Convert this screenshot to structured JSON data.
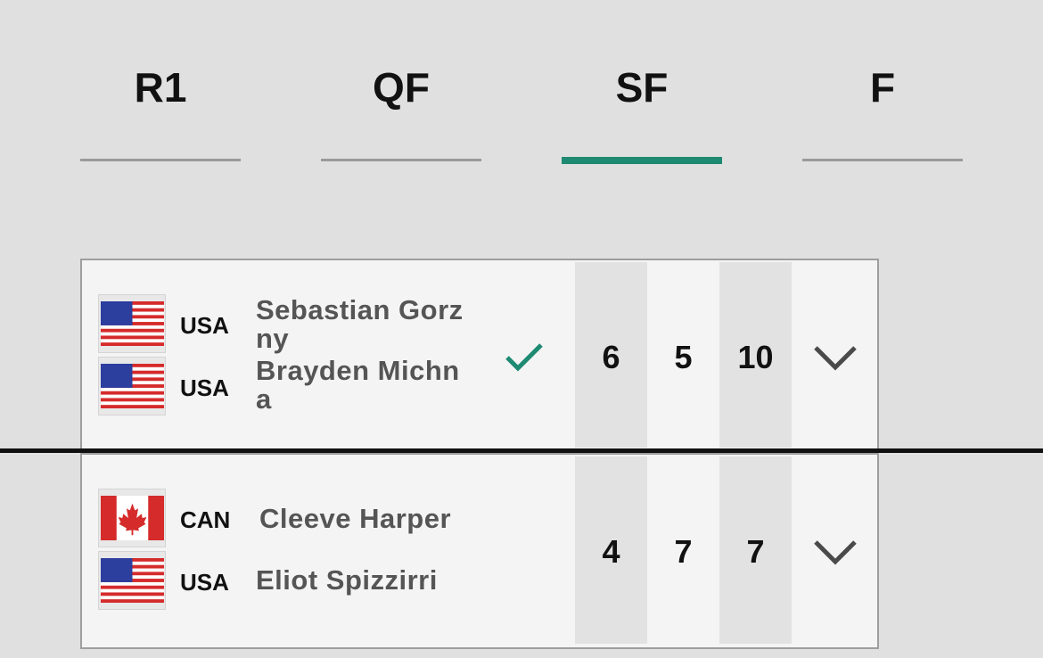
{
  "rounds": [
    {
      "label": "R1",
      "active": false
    },
    {
      "label": "QF",
      "active": false
    },
    {
      "label": "SF",
      "active": true
    },
    {
      "label": "F",
      "active": false
    }
  ],
  "colors": {
    "accent": "#1e8a72",
    "background": "#e0e0e0",
    "card": "#f4f4f4",
    "score_shade": "#e2e2e2"
  },
  "matches": [
    {
      "team": [
        {
          "country": "USA",
          "flag": "usa-flag-icon",
          "name": "Sebastian Gorzny"
        },
        {
          "country": "USA",
          "flag": "usa-flag-icon",
          "name": "Brayden Michna"
        }
      ],
      "winner": true,
      "scores": [
        "6",
        "5",
        "10"
      ]
    },
    {
      "team": [
        {
          "country": "CAN",
          "flag": "canada-flag-icon",
          "name": "Cleeve Harper"
        },
        {
          "country": "USA",
          "flag": "usa-flag-icon",
          "name": "Eliot Spizzirri"
        }
      ],
      "winner": false,
      "scores": [
        "4",
        "7",
        "7"
      ]
    }
  ]
}
